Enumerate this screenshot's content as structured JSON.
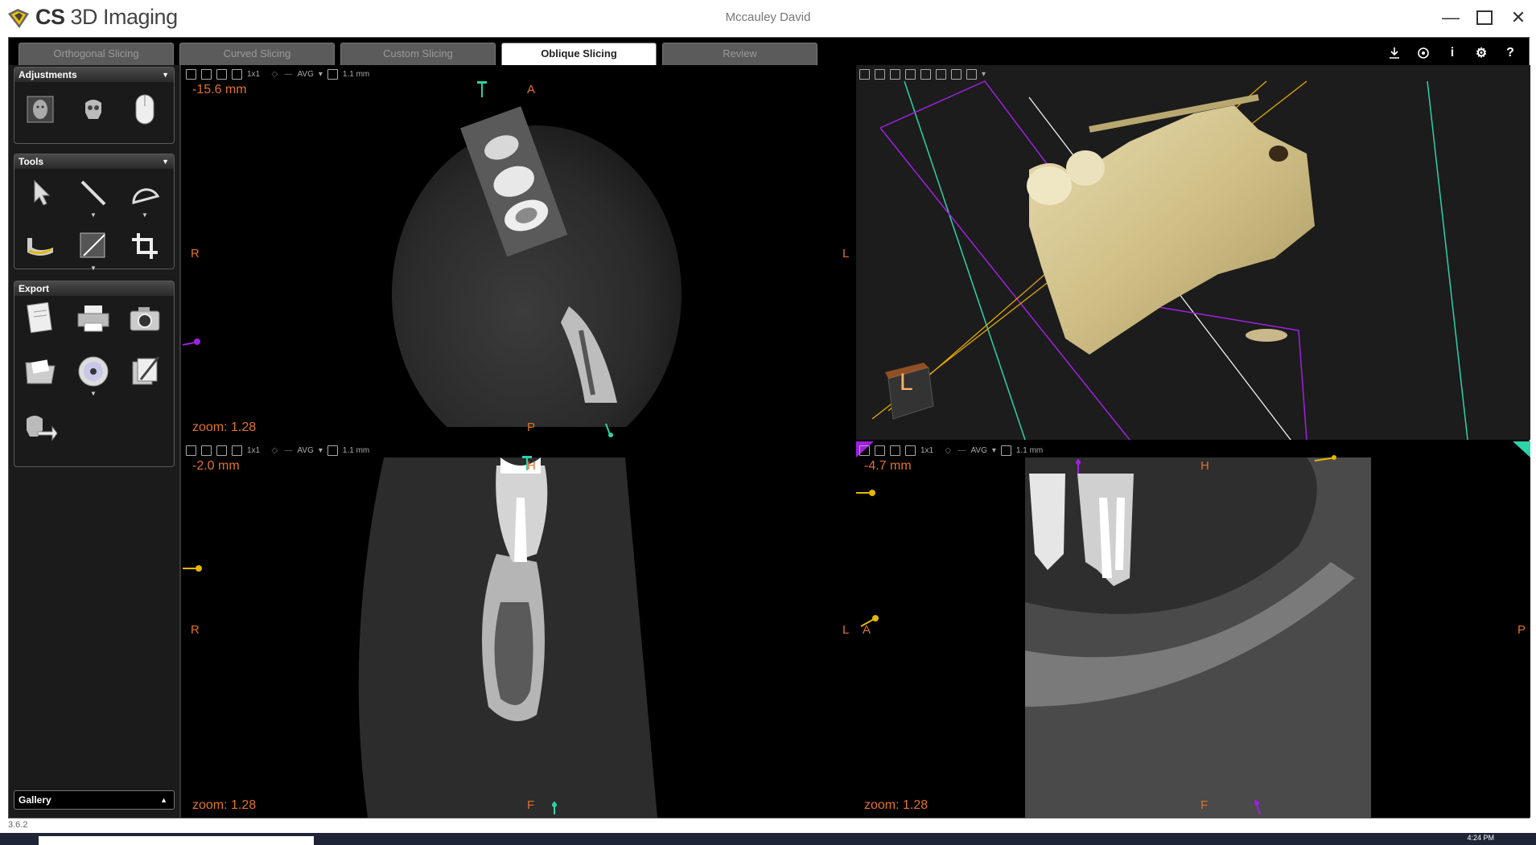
{
  "app": {
    "brand_bold": "CS",
    "brand_rest": " 3D Imaging",
    "window_title": "Mccauley David",
    "version": "3.6.2"
  },
  "tabs": [
    {
      "label": "Orthogonal Slicing",
      "active": false
    },
    {
      "label": "Curved Slicing",
      "active": false
    },
    {
      "label": "Custom Slicing",
      "active": false
    },
    {
      "label": "Oblique Slicing",
      "active": true
    },
    {
      "label": "Review",
      "active": false
    }
  ],
  "sidebar": {
    "adjustments_title": "Adjustments",
    "tools_title": "Tools",
    "export_title": "Export",
    "gallery_label": "Gallery"
  },
  "viewports": {
    "toolbar": {
      "layout": "1x1",
      "mode": "AVG",
      "thickness": "1.1 mm"
    },
    "top_left": {
      "depth": "-15.6 mm",
      "zoom": "zoom: 1.28",
      "top": "A",
      "bottom": "P",
      "left": "R",
      "right": "L"
    },
    "top_right": {
      "cube_label": "L"
    },
    "bottom_left": {
      "depth": "-2.0 mm",
      "zoom": "zoom: 1.28",
      "top": "H",
      "bottom": "F",
      "left": "R",
      "right": "L"
    },
    "bottom_right": {
      "depth": "-4.7 mm",
      "zoom": "zoom: 1.28",
      "top": "H",
      "bottom": "F",
      "left": "A",
      "right": "P"
    }
  },
  "taskbar": {
    "time": "4:24 PM"
  },
  "colors": {
    "overlay_orange": "#e0722a",
    "accent_cyan": "#2fd1a8",
    "accent_purple": "#a020e0",
    "accent_yellow": "#e6b800"
  }
}
